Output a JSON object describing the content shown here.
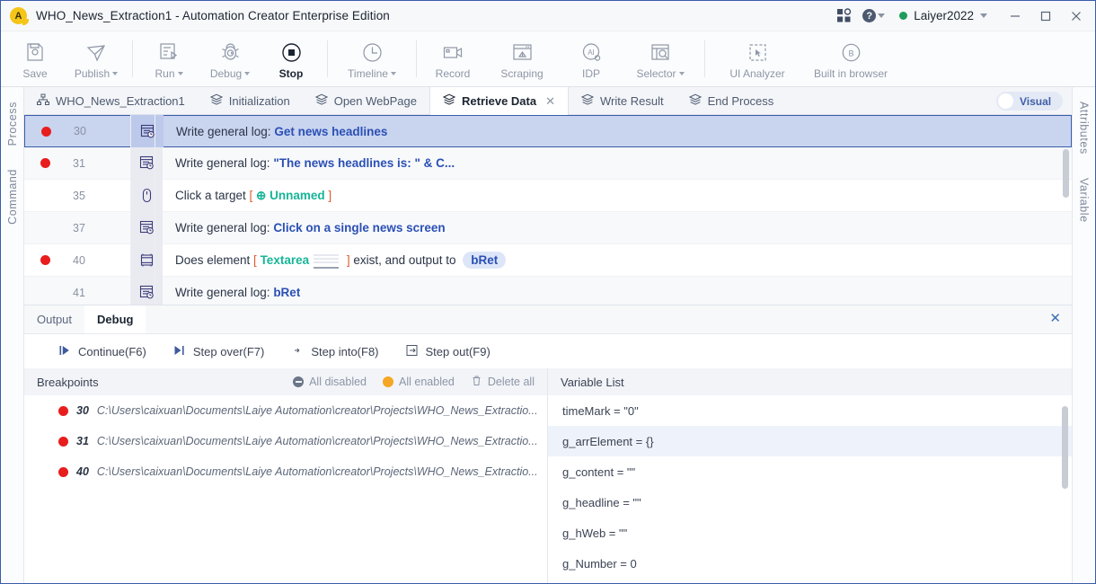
{
  "titlebar": {
    "logo_text": "A",
    "title": "WHO_News_Extraction1 - Automation Creator Enterprise Edition",
    "apps_icon": "apps-grid-icon",
    "help_icon": "help-circle-icon",
    "help_label": "?",
    "user_name": "Laiyer2022",
    "minimize_label": "—",
    "maximize_label": "☐",
    "close_label": "✕"
  },
  "ribbon": {
    "items": [
      {
        "label": "Save",
        "icon": "save-disk-icon",
        "caret": false,
        "active": false,
        "width": ""
      },
      {
        "label": "Publish",
        "icon": "publish-send-icon",
        "caret": true,
        "active": false,
        "width": ""
      },
      {
        "label": "Run",
        "icon": "run-list-icon",
        "caret": true,
        "active": false,
        "width": ""
      },
      {
        "label": "Debug",
        "icon": "debug-bug-icon",
        "caret": true,
        "active": false,
        "width": ""
      },
      {
        "label": "Stop",
        "icon": "stop-square-icon",
        "caret": false,
        "active": true,
        "width": ""
      },
      {
        "label": "Timeline",
        "icon": "timeline-clock-icon",
        "caret": true,
        "active": false,
        "width": "w-wide"
      },
      {
        "label": "Record",
        "icon": "record-camera-icon",
        "caret": false,
        "active": false,
        "width": ""
      },
      {
        "label": "Scraping",
        "icon": "scraping-window-icon",
        "caret": false,
        "active": false,
        "width": "w-wide"
      },
      {
        "label": "IDP",
        "icon": "idp-ai-icon",
        "caret": false,
        "active": false,
        "width": ""
      },
      {
        "label": "Selector",
        "icon": "selector-search-icon",
        "caret": true,
        "active": false,
        "width": "w-wide"
      },
      {
        "label": "UI Analyzer",
        "icon": "ui-analyzer-icon",
        "caret": false,
        "active": false,
        "width": "w-xwide"
      },
      {
        "label": "Built in browser",
        "icon": "browser-b-icon",
        "caret": false,
        "active": false,
        "width": "w-xwide"
      }
    ],
    "separators_after": [
      1,
      4,
      5,
      9
    ]
  },
  "left_rail": {
    "labels": [
      "Process",
      "Command"
    ]
  },
  "right_rail": {
    "labels": [
      "Attributes",
      "Variable"
    ]
  },
  "process_tabs": {
    "tabs": [
      {
        "label": "WHO_News_Extraction1",
        "icon": "sitemap-icon",
        "active": false,
        "closable": false
      },
      {
        "label": "Initialization",
        "icon": "layers-icon",
        "active": false,
        "closable": false
      },
      {
        "label": "Open WebPage",
        "icon": "layers-icon",
        "active": false,
        "closable": false
      },
      {
        "label": "Retrieve Data",
        "icon": "layers-icon",
        "active": true,
        "closable": true
      },
      {
        "label": "Write Result",
        "icon": "layers-icon",
        "active": false,
        "closable": false
      },
      {
        "label": "End Process",
        "icon": "layers-icon",
        "active": false,
        "closable": false
      }
    ],
    "visual_toggle_label": "Visual"
  },
  "steps": [
    {
      "breakpoint": true,
      "line": "30",
      "icon": "write-log-icon",
      "selected": true,
      "parts": [
        {
          "t": "Write general log: ",
          "s": "plain"
        },
        {
          "t": "Get news headlines",
          "s": "strong"
        }
      ]
    },
    {
      "breakpoint": true,
      "line": "31",
      "icon": "write-log-icon",
      "selected": false,
      "parts": [
        {
          "t": "Write general log: ",
          "s": "plain"
        },
        {
          "t": "\"The news headlines is:   \" & C...",
          "s": "strong"
        }
      ]
    },
    {
      "breakpoint": false,
      "line": "35",
      "icon": "mouse-click-icon",
      "selected": false,
      "parts": [
        {
          "t": "Click a target ",
          "s": "plain"
        },
        {
          "t": "[ ",
          "s": "bracket"
        },
        {
          "t": "⊕ Unnamed",
          "s": "target"
        },
        {
          "t": " ]",
          "s": "bracket"
        }
      ]
    },
    {
      "breakpoint": false,
      "line": "37",
      "icon": "write-log-icon",
      "selected": false,
      "parts": [
        {
          "t": "Write general log: ",
          "s": "plain"
        },
        {
          "t": "Click on a single news screen",
          "s": "strong"
        }
      ]
    },
    {
      "breakpoint": true,
      "line": "40",
      "icon": "element-exist-icon",
      "selected": false,
      "parts": [
        {
          "t": "Does element ",
          "s": "plain"
        },
        {
          "t": "[ ",
          "s": "bracket"
        },
        {
          "t": "Textarea",
          "s": "target"
        },
        {
          "t": "",
          "s": "thumb"
        },
        {
          "t": " ]",
          "s": "bracket"
        },
        {
          "t": " exist, and output to ",
          "s": "plain"
        },
        {
          "t": "bRet",
          "s": "var"
        }
      ]
    },
    {
      "breakpoint": false,
      "line": "41",
      "icon": "write-log-icon",
      "selected": false,
      "parts": [
        {
          "t": "Write general log: ",
          "s": "plain"
        },
        {
          "t": "bRet",
          "s": "strong"
        }
      ]
    }
  ],
  "bottom_panel": {
    "tabs": [
      {
        "label": "Output",
        "active": false
      },
      {
        "label": "Debug",
        "active": true
      }
    ],
    "close_label": "✕",
    "debug_buttons": [
      {
        "label": "Continue(F6)",
        "icon": "continue-play-icon"
      },
      {
        "label": "Step over(F7)",
        "icon": "step-over-icon"
      },
      {
        "label": "Step into(F8)",
        "icon": "step-into-icon"
      },
      {
        "label": "Step out(F9)",
        "icon": "step-out-icon"
      }
    ],
    "breakpoints": {
      "title": "Breakpoints",
      "actions": [
        {
          "label": "All disabled",
          "icon": "minus-circle-icon"
        },
        {
          "label": "All enabled",
          "icon": "filled-circle-icon"
        },
        {
          "label": "Delete all",
          "icon": "trash-icon"
        }
      ],
      "rows": [
        {
          "num": "30",
          "path": "C:\\Users\\caixuan\\Documents\\Laiye Automation\\creator\\Projects\\WHO_News_Extractio..."
        },
        {
          "num": "31",
          "path": "C:\\Users\\caixuan\\Documents\\Laiye Automation\\creator\\Projects\\WHO_News_Extractio..."
        },
        {
          "num": "40",
          "path": "C:\\Users\\caixuan\\Documents\\Laiye Automation\\creator\\Projects\\WHO_News_Extractio..."
        }
      ]
    },
    "variables": {
      "title": "Variable List",
      "rows": [
        {
          "text": "timeMark = \"0\"",
          "highlight": false
        },
        {
          "text": "g_arrElement = {}",
          "highlight": true
        },
        {
          "text": "g_content = \"\"",
          "highlight": false
        },
        {
          "text": "g_headline = \"\"",
          "highlight": false
        },
        {
          "text": "g_hWeb = \"\"",
          "highlight": false
        },
        {
          "text": "g_Number = 0",
          "highlight": false
        }
      ]
    }
  },
  "colors": {
    "accent": "#2b50b5",
    "breakpoint_red": "#e81d1d",
    "target_green": "#17b597",
    "status_green": "#1f9c5b",
    "enabled_orange": "#f5a623",
    "selection_blue": "#c9d4ef"
  }
}
